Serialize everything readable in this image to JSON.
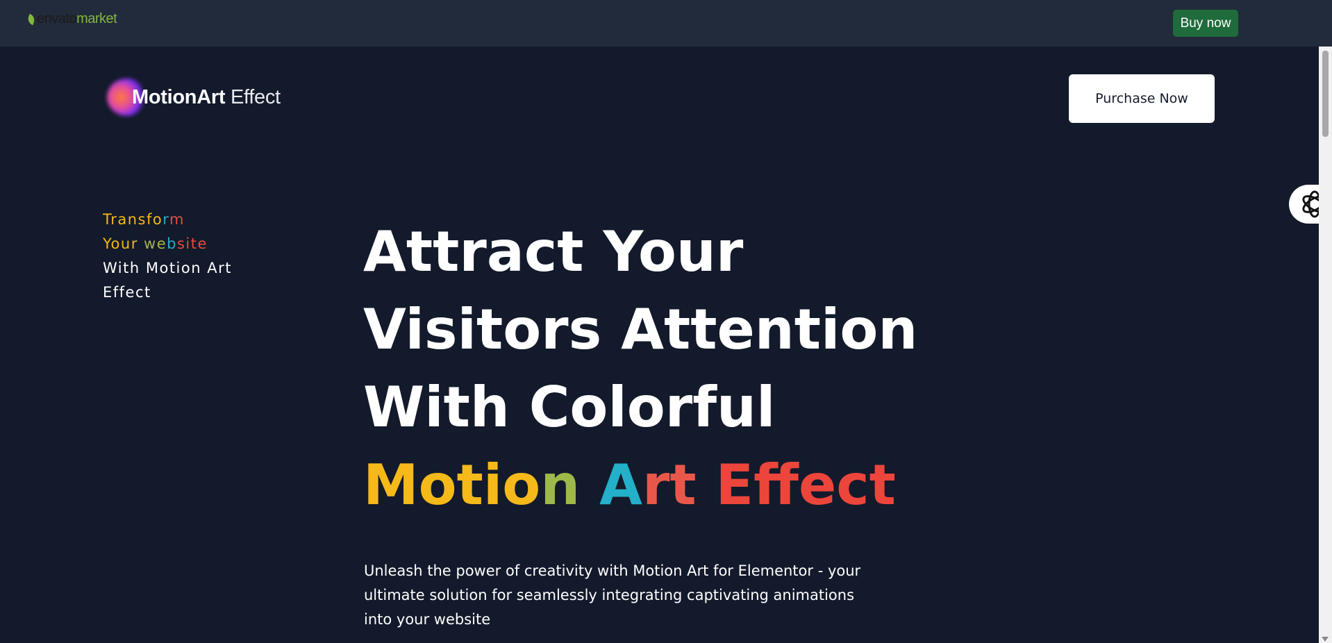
{
  "topbar": {
    "logo_word": "envato",
    "logo_market": "market",
    "buy_now_label": "Buy now",
    "buy_now_color": "#1f6b3b"
  },
  "header": {
    "brand_bold": "MotionArt",
    "brand_light": "Effect",
    "purchase_label": "Purchase Now"
  },
  "tagline": {
    "line1_a": "Transfo",
    "line1_b": "r",
    "line1_c": "m",
    "line2_a": "Your ",
    "line2_b": "we",
    "line2_c": "b",
    "line2_d": "site",
    "line3": "With Motion Art",
    "line4": "Effect"
  },
  "hero": {
    "line1": "Attract Your",
    "line2": "Visitors Attention",
    "line3": "With Colorful",
    "motion_a": "Motio",
    "motion_b": "n",
    "art_a": "A",
    "art_b": "rt",
    "effect": "Effect",
    "description": "Unleash the power of creativity with Motion Art for Elementor - your ultimate solution for seamlessly integrating captivating animations into your website"
  },
  "floating": {
    "icon": "openai-icon"
  },
  "colors": {
    "background": "#131a2b",
    "topbar": "#222b3b",
    "gold": "#f5b91a",
    "teal": "#23b0c8",
    "red": "#ec453b"
  }
}
